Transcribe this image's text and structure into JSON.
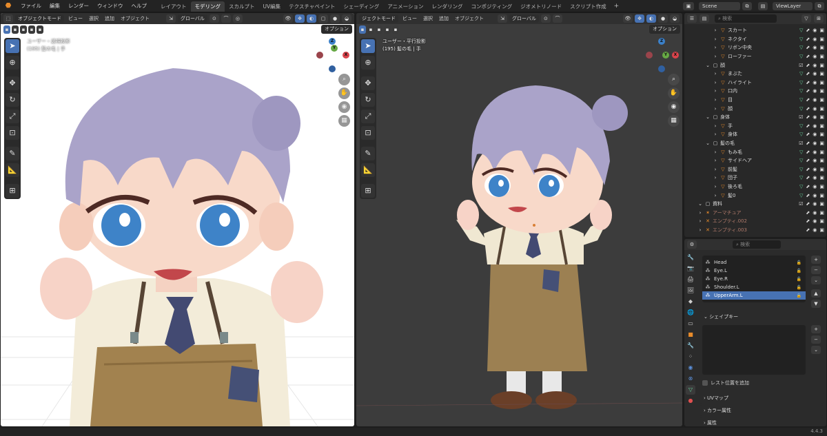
{
  "topbar": {
    "menus": [
      "ファイル",
      "編集",
      "レンダー",
      "ウィンドウ",
      "ヘルプ"
    ],
    "workspaces": [
      "レイアウト",
      "モデリング",
      "スカルプト",
      "UV編集",
      "テクスチャペイント",
      "シェーディング",
      "アニメーション",
      "レンダリング",
      "コンポジティング",
      "ジオメトリノード",
      "スクリプト作成"
    ],
    "active_workspace": "モデリング",
    "scene": "Scene",
    "view_layer": "ViewLayer"
  },
  "viewport_left": {
    "mode": "オブジェクトモード",
    "menus": [
      "ビュー",
      "選択",
      "追加",
      "オブジェクト"
    ],
    "orientation": "グローバル",
    "options": "オプション",
    "view_name": "ユーザー・透視投影",
    "object_info": "(195) 髪の毛 | 手",
    "background": "#ffffff"
  },
  "viewport_right": {
    "header_fragment": "ジェクトモード",
    "menus": [
      "ビュー",
      "選択",
      "追加",
      "オブジェクト"
    ],
    "orientation": "グローバル",
    "options": "オプション",
    "view_name": "ユーザー・平行投影",
    "object_info": "(195) 髪の毛 | 手",
    "background": "#3c3c3c"
  },
  "outliner": {
    "search_placeholder": "検索",
    "rows": [
      {
        "label": "スカート",
        "depth": 3,
        "kind": "mesh-data"
      },
      {
        "label": "ネクタイ",
        "depth": 3,
        "kind": "mesh-data"
      },
      {
        "label": "リボン中央",
        "depth": 3,
        "kind": "mesh-data"
      },
      {
        "label": "ローファー",
        "depth": 3,
        "kind": "mesh-data"
      },
      {
        "label": "顔",
        "depth": 2,
        "kind": "collection"
      },
      {
        "label": "まぶた",
        "depth": 3,
        "kind": "mesh-data"
      },
      {
        "label": "ハイライト",
        "depth": 3,
        "kind": "mesh-data"
      },
      {
        "label": "口内",
        "depth": 3,
        "kind": "mesh-data"
      },
      {
        "label": "目",
        "depth": 3,
        "kind": "mesh-data"
      },
      {
        "label": "顔",
        "depth": 3,
        "kind": "mesh-data"
      },
      {
        "label": "身体",
        "depth": 2,
        "kind": "collection"
      },
      {
        "label": "手",
        "depth": 3,
        "kind": "mesh-data"
      },
      {
        "label": "身体",
        "depth": 3,
        "kind": "mesh-data"
      },
      {
        "label": "髪の毛",
        "depth": 2,
        "kind": "collection"
      },
      {
        "label": "もみ毛",
        "depth": 3,
        "kind": "mesh-data"
      },
      {
        "label": "サイドヘア",
        "depth": 3,
        "kind": "mesh-data"
      },
      {
        "label": "前髪",
        "depth": 3,
        "kind": "mesh-data"
      },
      {
        "label": "団子",
        "depth": 3,
        "kind": "mesh-data"
      },
      {
        "label": "後ろ毛",
        "depth": 3,
        "kind": "mesh-data"
      },
      {
        "label": "髪0",
        "depth": 3,
        "kind": "mesh-data"
      },
      {
        "label": "資料",
        "depth": 1,
        "kind": "collection"
      },
      {
        "label": "アーマチュア",
        "depth": 1,
        "kind": "armature"
      },
      {
        "label": "エンプティ.002",
        "depth": 1,
        "kind": "empty"
      },
      {
        "label": "エンプティ.003",
        "depth": 1,
        "kind": "empty"
      }
    ]
  },
  "properties": {
    "search_placeholder": "検索",
    "vertex_groups": [
      "Head",
      "Eye.L",
      "Eye.R",
      "Shoulder.L",
      "UpperArm.L"
    ],
    "selected_group": "UpperArm.L",
    "shape_keys_label": "シェイプキー",
    "relative_label": "レスト位置を追加",
    "panels": [
      "UVマップ",
      "カラー属性",
      "属性"
    ]
  },
  "statusbar": {
    "version": "4.4.3"
  },
  "colors": {
    "accent": "#4772b3",
    "orange": "#e88b2b",
    "hair": "#a9a1c8",
    "skirt": "#9c8052"
  }
}
